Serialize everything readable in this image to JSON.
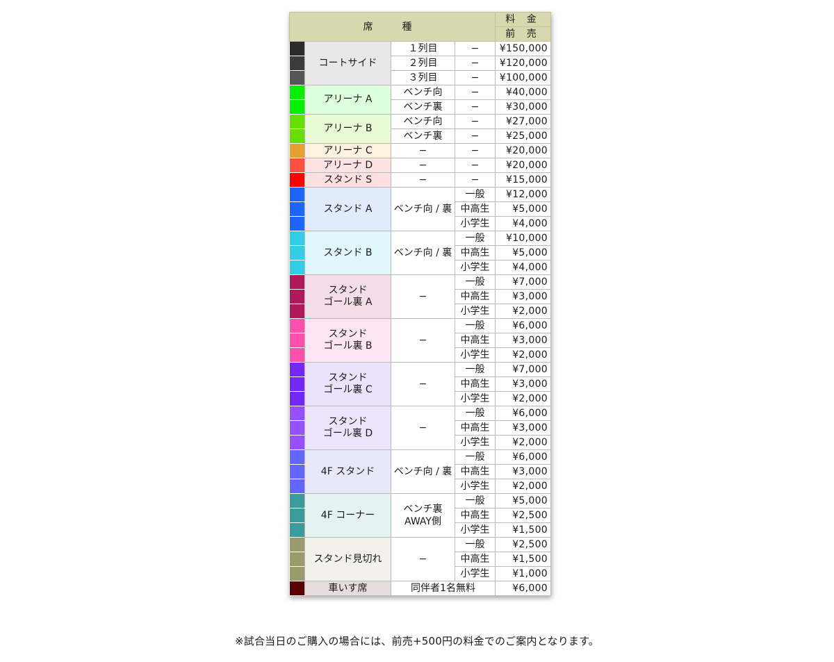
{
  "header": {
    "seat_type": "席　種",
    "fee": "料 金",
    "advance": "前 売"
  },
  "dash": "−",
  "groups": [
    {
      "name": "コートサイド",
      "bg": "#e8e8e8",
      "rows": [
        {
          "swatch": "#2b2b2b",
          "sub": "１列目",
          "cat": "−",
          "price": "¥150,000"
        },
        {
          "swatch": "#3c3c3c",
          "sub": "２列目",
          "cat": "−",
          "price": "¥120,000"
        },
        {
          "swatch": "#555555",
          "sub": "３列目",
          "cat": "−",
          "price": "¥100,000"
        }
      ]
    },
    {
      "name": "アリーナ A",
      "bg": "#ddffdd",
      "rows": [
        {
          "swatch": "#00f000",
          "sub": "ベンチ向",
          "cat": "−",
          "price": "¥40,000"
        },
        {
          "swatch": "#00f000",
          "sub": "ベンチ裏",
          "cat": "−",
          "price": "¥30,000"
        }
      ]
    },
    {
      "name": "アリーナ B",
      "bg": "#e9fbd6",
      "rows": [
        {
          "swatch": "#64e000",
          "sub": "ベンチ向",
          "cat": "−",
          "price": "¥27,000"
        },
        {
          "swatch": "#64e000",
          "sub": "ベンチ裏",
          "cat": "−",
          "price": "¥25,000"
        }
      ]
    },
    {
      "name": "アリーナ C",
      "bg": "#fdf1e0",
      "rows": [
        {
          "swatch": "#e8a032",
          "sub": "−",
          "cat": "−",
          "price": "¥20,000"
        }
      ]
    },
    {
      "name": "アリーナ D",
      "bg": "#fde4e2",
      "rows": [
        {
          "swatch": "#ff4f42",
          "sub": "−",
          "cat": "−",
          "price": "¥20,000"
        }
      ]
    },
    {
      "name": "スタンド S",
      "bg": "#ffe0e0",
      "rows": [
        {
          "swatch": "#ff0000",
          "sub": "−",
          "cat": "−",
          "price": "¥15,000"
        }
      ]
    },
    {
      "name": "スタンド A",
      "bg": "#e1ebfb",
      "sub": "ベンチ向 / 裏",
      "rows": [
        {
          "swatch": "#1e64ff",
          "cat": "一般",
          "price": "¥12,000"
        },
        {
          "swatch": "#1e64ff",
          "cat": "中高生",
          "price": "¥5,000"
        },
        {
          "swatch": "#1e64ff",
          "cat": "小学生",
          "price": "¥4,000"
        }
      ]
    },
    {
      "name": "スタンド B",
      "bg": "#e0f7fb",
      "sub": "ベンチ向 / 裏",
      "rows": [
        {
          "swatch": "#32cde6",
          "cat": "一般",
          "price": "¥10,000"
        },
        {
          "swatch": "#32cde6",
          "cat": "中高生",
          "price": "¥5,000"
        },
        {
          "swatch": "#32cde6",
          "cat": "小学生",
          "price": "¥4,000"
        }
      ]
    },
    {
      "name": "スタンド\nゴール裏 A",
      "bg": "#f5dde8",
      "sub": "−",
      "rows": [
        {
          "swatch": "#b0185a",
          "cat": "一般",
          "price": "¥7,000"
        },
        {
          "swatch": "#b0185a",
          "cat": "中高生",
          "price": "¥3,000"
        },
        {
          "swatch": "#b0185a",
          "cat": "小学生",
          "price": "¥2,000"
        }
      ]
    },
    {
      "name": "スタンド\nゴール裏 B",
      "bg": "#fde4f2",
      "sub": "−",
      "rows": [
        {
          "swatch": "#ff50aa",
          "cat": "一般",
          "price": "¥6,000"
        },
        {
          "swatch": "#ff50aa",
          "cat": "中高生",
          "price": "¥3,000"
        },
        {
          "swatch": "#ff50aa",
          "cat": "小学生",
          "price": "¥2,000"
        }
      ]
    },
    {
      "name": "スタンド\nゴール裏 C",
      "bg": "#ebe2fd",
      "sub": "−",
      "rows": [
        {
          "swatch": "#7328f5",
          "cat": "一般",
          "price": "¥7,000"
        },
        {
          "swatch": "#7328f5",
          "cat": "中高生",
          "price": "¥3,000"
        },
        {
          "swatch": "#7328f5",
          "cat": "小学生",
          "price": "¥2,000"
        }
      ]
    },
    {
      "name": "スタンド\nゴール裏 D",
      "bg": "#efe4fd",
      "sub": "−",
      "rows": [
        {
          "swatch": "#9650ff",
          "cat": "一般",
          "price": "¥6,000"
        },
        {
          "swatch": "#9650ff",
          "cat": "中高生",
          "price": "¥3,000"
        },
        {
          "swatch": "#9650ff",
          "cat": "小学生",
          "price": "¥2,000"
        }
      ]
    },
    {
      "name": "4F スタンド",
      "bg": "#e8e8fb",
      "sub": "ベンチ向 / 裏",
      "rows": [
        {
          "swatch": "#6464ff",
          "cat": "一般",
          "price": "¥6,000"
        },
        {
          "swatch": "#6464ff",
          "cat": "中高生",
          "price": "¥3,000"
        },
        {
          "swatch": "#6464ff",
          "cat": "小学生",
          "price": "¥2,000"
        }
      ]
    },
    {
      "name": "4F コーナー",
      "bg": "#e4f2f1",
      "sub": "ベンチ裏\nAWAY側",
      "rows": [
        {
          "swatch": "#3c9b9b",
          "cat": "一般",
          "price": "¥5,000"
        },
        {
          "swatch": "#3c9b9b",
          "cat": "中高生",
          "price": "¥2,500"
        },
        {
          "swatch": "#3c9b9b",
          "cat": "小学生",
          "price": "¥1,500"
        }
      ]
    },
    {
      "name": "スタンド見切れ",
      "bg": "#f2f2ea",
      "sub": "−",
      "rows": [
        {
          "swatch": "#9b9b6a",
          "cat": "一般",
          "price": "¥2,500"
        },
        {
          "swatch": "#9b9b6a",
          "cat": "中高生",
          "price": "¥1,500"
        },
        {
          "swatch": "#9b9b6a",
          "cat": "小学生",
          "price": "¥1,000"
        }
      ]
    },
    {
      "name": "車いす席",
      "bg": "#e6dcdc",
      "subspan": "同伴者1名無料",
      "rows": [
        {
          "swatch": "#5a0000",
          "price": "¥6,000"
        }
      ]
    }
  ],
  "footnote": "※試合当日のご購入の場合には、前売+500円の料金でのご案内となります。"
}
